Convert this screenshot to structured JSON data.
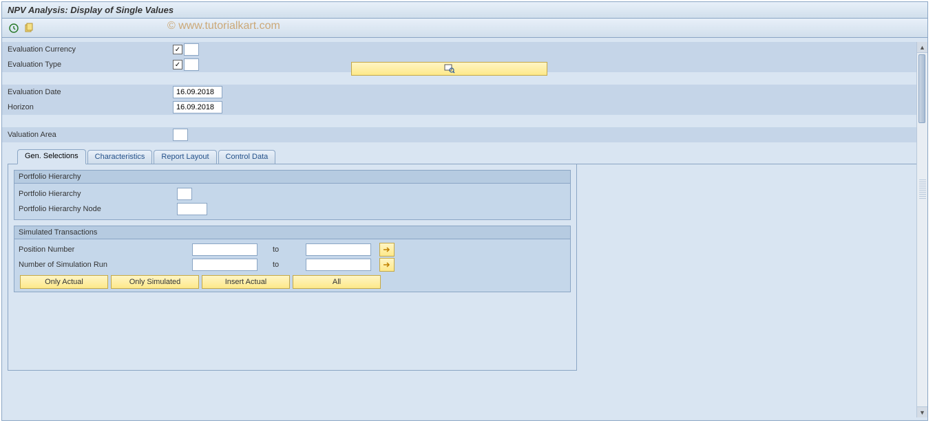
{
  "title": "NPV Analysis: Display of Single Values",
  "watermark": "© www.tutorialkart.com",
  "fields": {
    "eval_currency_label": "Evaluation Currency",
    "eval_currency_value": "",
    "eval_type_label": "Evaluation Type",
    "eval_type_value": "",
    "eval_date_label": "Evaluation Date",
    "eval_date_value": "16.09.2018",
    "horizon_label": "Horizon",
    "horizon_value": "16.09.2018",
    "valuation_area_label": "Valuation Area",
    "valuation_area_value": ""
  },
  "tabs": {
    "t0": "Gen. Selections",
    "t1": "Characteristics",
    "t2": "Report Layout",
    "t3": "Control Data"
  },
  "group1": {
    "title": "Portfolio Hierarchy",
    "row1": "Portfolio Hierarchy",
    "row2": "Portfolio Hierarchy Node"
  },
  "group2": {
    "title": "Simulated Transactions",
    "row1": "Position Number",
    "row2": "Number of Simulation Run",
    "to": "to"
  },
  "buttons": {
    "b0": "Only Actual",
    "b1": "Only Simulated",
    "b2": "Insert Actual",
    "b3": "All"
  }
}
